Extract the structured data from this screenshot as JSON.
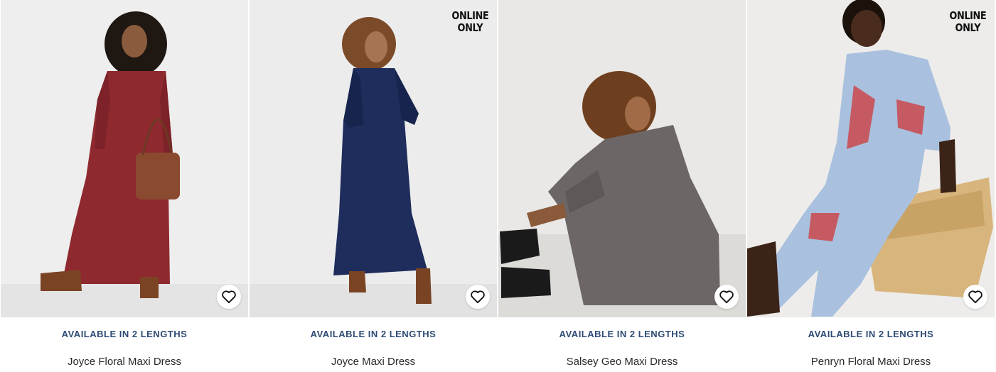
{
  "products": [
    {
      "badge": "",
      "lengths": "AVAILABLE IN 2 LENGTHS",
      "name": "Joyce Floral Maxi Dress",
      "bg": "#eeeeee",
      "dress": "#8e2a2f"
    },
    {
      "badge": "ONLINE ONLY",
      "lengths": "AVAILABLE IN 2 LENGTHS",
      "name": "Joyce Maxi Dress",
      "bg": "#ececec",
      "dress": "#1e2d5c"
    },
    {
      "badge": "",
      "lengths": "AVAILABLE IN 2 LENGTHS",
      "name": "Salsey Geo Maxi Dress",
      "bg": "#e9e8e6",
      "dress": "#6c6666"
    },
    {
      "badge": "ONLINE ONLY",
      "lengths": "AVAILABLE IN 2 LENGTHS",
      "name": "Penryn Floral Maxi Dress",
      "bg": "#edecea",
      "dress": "#a9c1de"
    }
  ],
  "icons": {
    "wishlist": "heart-outline-icon"
  }
}
